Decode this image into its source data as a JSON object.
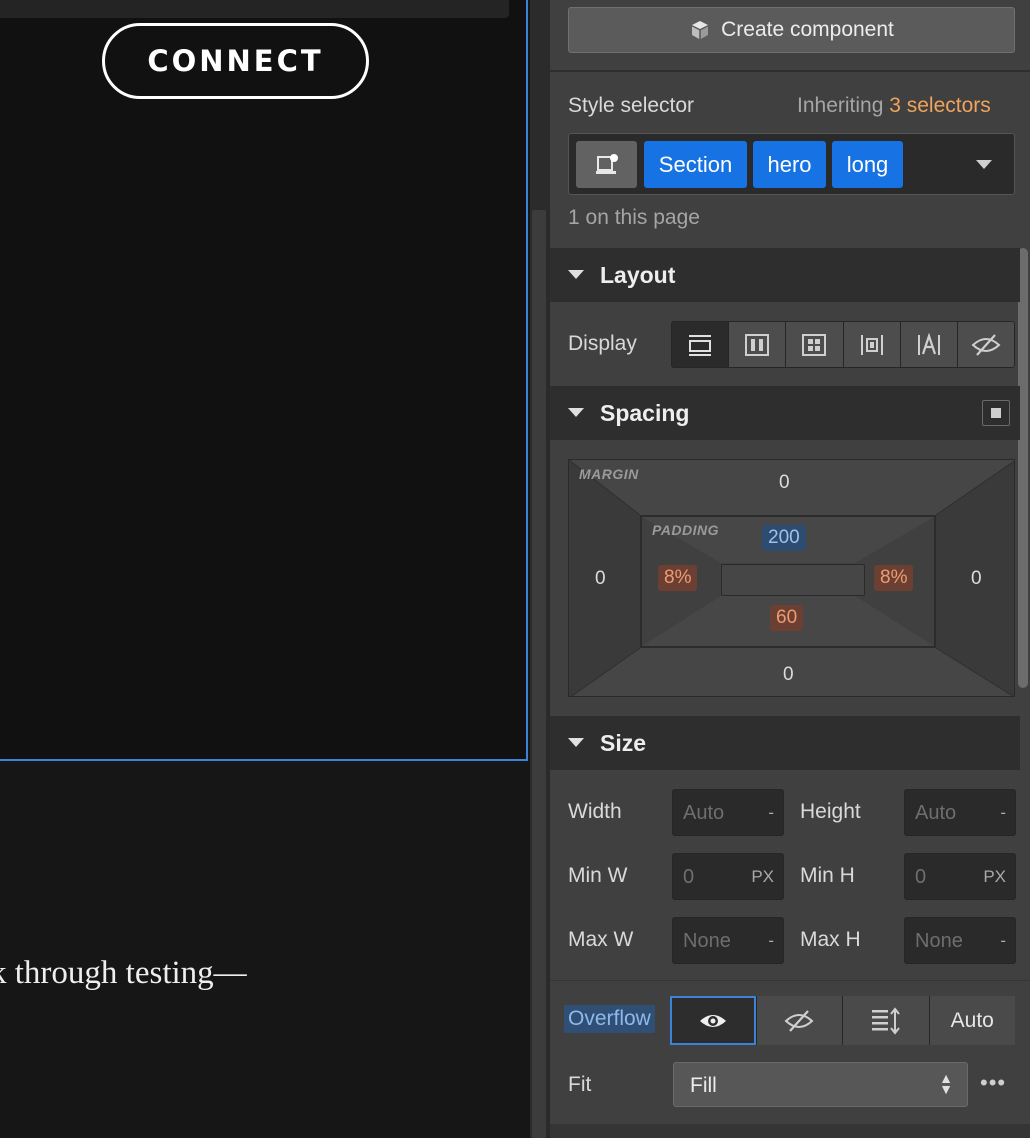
{
  "canvas": {
    "connect_label": "CONNECT",
    "body_text": "k through testing—"
  },
  "panel": {
    "create_component": {
      "icon": "cube-icon",
      "label": "Create component"
    },
    "style_selector": {
      "label": "Style selector",
      "inheriting_prefix": "Inheriting",
      "inheriting_link": "3 selectors",
      "chips": [
        "Section",
        "hero",
        "long"
      ],
      "count_text": "1 on this page"
    },
    "layout": {
      "title": "Layout",
      "display_label": "Display",
      "display_options": [
        "block",
        "flex",
        "grid",
        "inline-block",
        "inline",
        "none"
      ]
    },
    "spacing": {
      "title": "Spacing",
      "margin_caption": "MARGIN",
      "padding_caption": "PADDING",
      "margin": {
        "top": "0",
        "right": "0",
        "bottom": "0",
        "left": "0"
      },
      "padding": {
        "top": "200",
        "right": "8%",
        "bottom": "60",
        "left": "8%"
      }
    },
    "size": {
      "title": "Size",
      "width": {
        "label": "Width",
        "value": "Auto",
        "unit": "-"
      },
      "height": {
        "label": "Height",
        "value": "Auto",
        "unit": "-"
      },
      "min_w": {
        "label": "Min W",
        "value": "0",
        "unit": "PX"
      },
      "min_h": {
        "label": "Min H",
        "value": "0",
        "unit": "PX"
      },
      "max_w": {
        "label": "Max W",
        "value": "None",
        "unit": "-"
      },
      "max_h": {
        "label": "Max H",
        "value": "None",
        "unit": "-"
      }
    },
    "overflow": {
      "label": "Overflow",
      "auto_label": "Auto",
      "selected": "visible"
    },
    "fit": {
      "label": "Fit",
      "value": "Fill",
      "more": "•••"
    },
    "colors": {
      "accent": "#1772e3",
      "orange": "#f0a35c",
      "selection": "#3b82d9"
    }
  }
}
